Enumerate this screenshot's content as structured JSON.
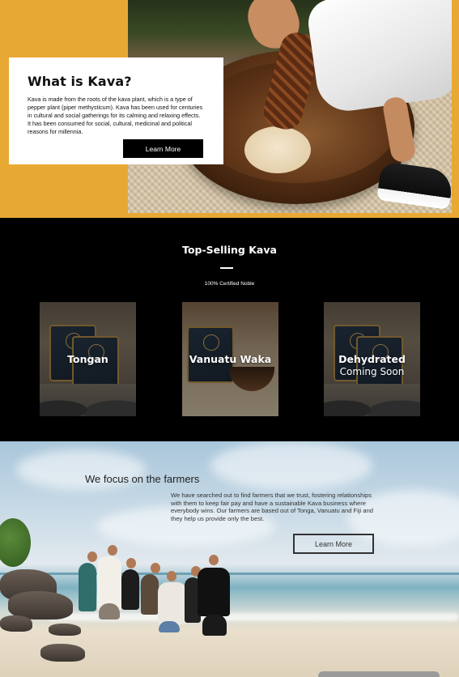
{
  "hero": {
    "title": "What is Kava?",
    "body": "Kava is made from the roots of the kava plant, which is a type of pepper plant (piper methysticum). Kava has been used for centuries in cultural and social gatherings for its calming and relaxing effects. It has been consumed for social, cultural, medicinal and political reasons for millennia.",
    "button_label": "Learn More",
    "accent_color": "#e8a934"
  },
  "top_selling": {
    "title": "Top-Selling Kava",
    "subtitle": "100% Certified Noble",
    "products": [
      {
        "name": "Tongan",
        "note": ""
      },
      {
        "name": "Vanuatu Waka",
        "note": ""
      },
      {
        "name": "Dehydrated",
        "note": "Coming Soon"
      }
    ]
  },
  "farmers": {
    "title": "We focus on the farmers",
    "body": "We have searched out to find farmers that we trust, fostering relationships with them to keep fair pay and have a sustainable Kava business where everybody wins. Our farmers are based out of Tonga, Vanuatu and Fiji and they help us provide only the best.",
    "button_label": "Learn More"
  }
}
